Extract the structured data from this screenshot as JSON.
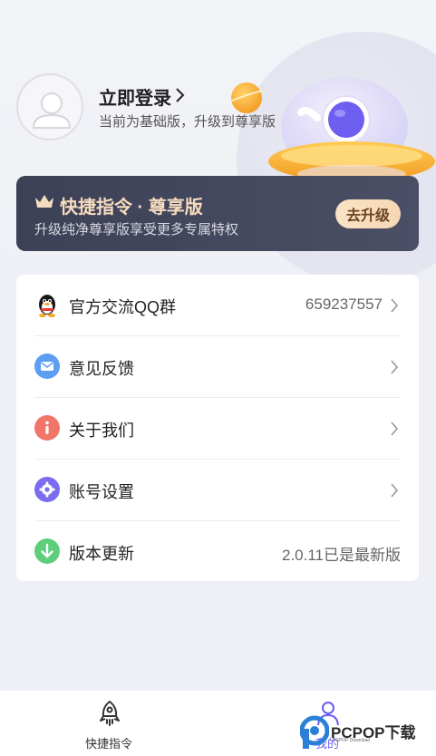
{
  "header": {
    "login_title": "立即登录",
    "login_subtitle": "当前为基础版，升级到尊享版"
  },
  "premium": {
    "title": "快捷指令 · 尊享版",
    "subtitle": "升级纯净尊享版享受更多专属特权",
    "button_label": "去升级"
  },
  "menu": {
    "items": [
      {
        "label": "官方交流QQ群",
        "value": "659237557",
        "icon": "qq-penguin-icon"
      },
      {
        "label": "意见反馈",
        "value": "",
        "icon": "mail-icon"
      },
      {
        "label": "关于我们",
        "value": "",
        "icon": "info-icon"
      },
      {
        "label": "账号设置",
        "value": "",
        "icon": "gear-icon"
      },
      {
        "label": "版本更新",
        "value": "2.0.11已是最新版",
        "icon": "download-arrow-icon"
      }
    ]
  },
  "bottom_nav": {
    "items": [
      {
        "label": "快捷指令",
        "icon": "rocket-icon"
      },
      {
        "label": "我的",
        "icon": "profile-icon"
      }
    ]
  },
  "watermark": {
    "text": "PCPOP下载",
    "sub": "PCPOP Download"
  },
  "colors": {
    "accent": "#6b5cf0",
    "premium_bg": "#3d4156",
    "premium_title": "#f6dcbf",
    "upgrade_button": "#f8ddbd"
  }
}
